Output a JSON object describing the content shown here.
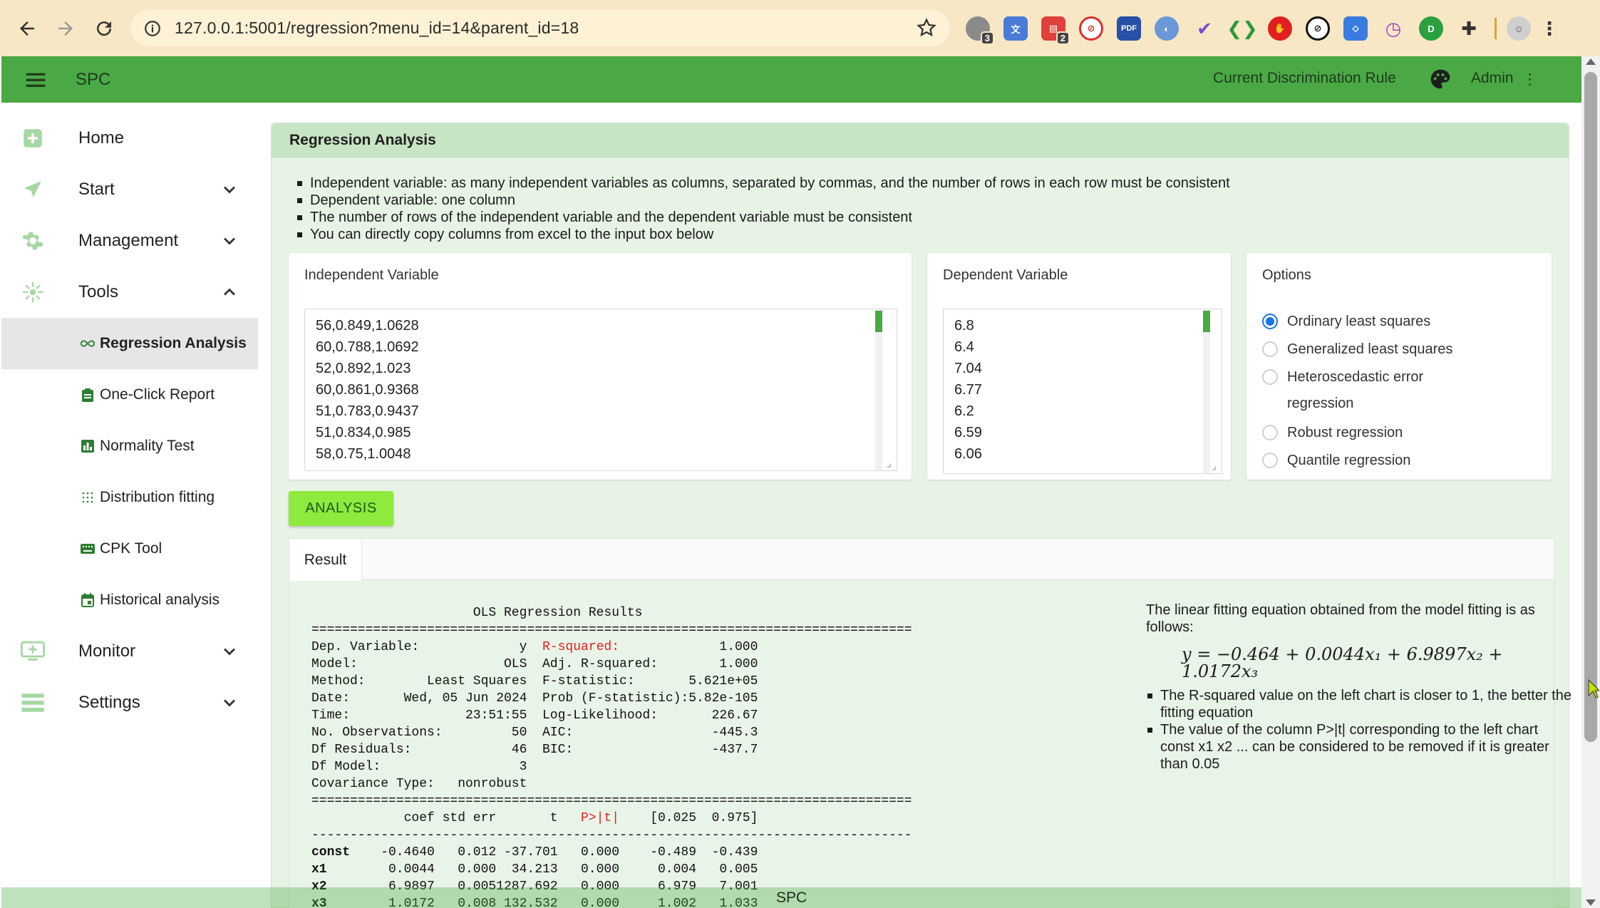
{
  "browser": {
    "url": "127.0.0.1:5001/regression?menu_id=14&parent_id=18",
    "extension_badges": {
      "first": "3",
      "calendar": "2"
    }
  },
  "appbar": {
    "title": "SPC",
    "rule_label": "Current Discrimination Rule",
    "user": "Admin",
    "accent": "#4aa944"
  },
  "sidebar": {
    "items": [
      {
        "label": "Home",
        "icon": "home-icon"
      },
      {
        "label": "Start",
        "icon": "send-icon"
      },
      {
        "label": "Management",
        "icon": "gear-icon"
      },
      {
        "label": "Tools",
        "icon": "tools-icon"
      },
      {
        "label": "Monitor",
        "icon": "monitor-icon"
      },
      {
        "label": "Settings",
        "icon": "settings-icon"
      }
    ],
    "tools_sub": [
      {
        "label": "Regression Analysis",
        "icon": "infinity-icon"
      },
      {
        "label": "One-Click Report",
        "icon": "clipboard-icon"
      },
      {
        "label": "Normality Test",
        "icon": "bar-chart-icon"
      },
      {
        "label": "Distribution fitting",
        "icon": "grid-dots-icon"
      },
      {
        "label": "CPK Tool",
        "icon": "keyboard-icon"
      },
      {
        "label": "Historical analysis",
        "icon": "calendar-icon"
      }
    ]
  },
  "card": {
    "title": "Regression Analysis",
    "notes": [
      "Independent variable: as many independent variables as columns, separated by commas, and the number of rows in each row must be consistent",
      "Dependent variable: one column",
      "The number of rows of the independent variable and the dependent variable must be consistent",
      "You can directly copy columns from excel to the input box below"
    ]
  },
  "independent": {
    "title": "Independent Variable",
    "lines": [
      "56,0.849,1.0628",
      "60,0.788,1.0692",
      "52,0.892,1.023",
      "60,0.861,0.9368",
      "51,0.783,0.9437",
      "51,0.834,0.985",
      "58,0.75,1.0048"
    ]
  },
  "dependent": {
    "title": "Dependent Variable",
    "lines": [
      "6.8",
      "6.4",
      "7.04",
      "6.77",
      "6.2",
      "6.59",
      "6.06"
    ]
  },
  "options": {
    "title": "Options",
    "items": [
      {
        "label": "Ordinary least squares",
        "selected": true
      },
      {
        "label": "Generalized least squares",
        "selected": false
      },
      {
        "label": "Heteroscedastic error regression",
        "selected": false
      },
      {
        "label": "Robust regression",
        "selected": false
      },
      {
        "label": "Quantile regression",
        "selected": false
      }
    ]
  },
  "analyze_label": "ANALYSIS",
  "result": {
    "tab": "Result",
    "ols_title": "OLS Regression Results",
    "rule_eq": "==============================================================================",
    "rule_dash": "------------------------------------------------------------------------------",
    "left_labels": [
      "Dep. Variable:",
      "Model:",
      "Method:",
      "Date:",
      "Time:",
      "No. Observations:",
      "Df Residuals:",
      "Df Model:",
      "Covariance Type:"
    ],
    "left_values": [
      "y",
      "OLS",
      "Least Squares",
      "Wed, 05 Jun 2024",
      "23:51:55",
      "50",
      "46",
      "3",
      "nonrobust"
    ],
    "right_labels": [
      "R-squared:",
      "Adj. R-squared:",
      "F-statistic:",
      "Prob (F-statistic):",
      "Log-Likelihood:",
      "AIC:",
      "BIC:"
    ],
    "right_values": [
      "1.000",
      "1.000",
      "5.621e+05",
      "5.82e-105",
      "226.67",
      "-445.3",
      "-437.7"
    ],
    "coef_header": [
      "coef",
      "std err",
      "t",
      "P>|t|",
      "[0.025",
      "0.975]"
    ],
    "coef_rows": [
      [
        "const",
        "-0.4640",
        "0.012",
        "-37.701",
        "0.000",
        "-0.489",
        "-0.439"
      ],
      [
        "x1",
        "0.0044",
        "0.000",
        "34.213",
        "0.000",
        "0.004",
        "0.005"
      ],
      [
        "x2",
        "6.9897",
        "0.005",
        "1287.692",
        "0.000",
        "6.979",
        "7.001"
      ],
      [
        "x3",
        "1.0172",
        "0.008",
        "132.532",
        "0.000",
        "1.002",
        "1.033"
      ]
    ],
    "side_intro": "The linear fitting equation obtained from the model fitting is as follows:",
    "equation": "y = −0.464 + 0.0044x₁ + 6.9897x₂ + 1.0172x₃",
    "side_notes": [
      "The R-squared value on the left chart is closer to 1, the better the fitting equation",
      "The value of the column P>|t| corresponding to the left chart const x1 x2 ... can be considered to be removed if it is greater than 0.05"
    ]
  },
  "footer": "SPC"
}
